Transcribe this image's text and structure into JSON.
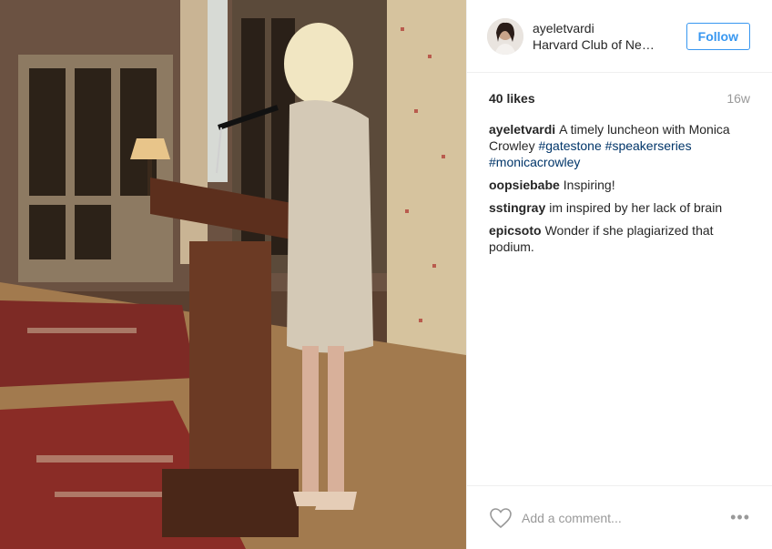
{
  "post": {
    "username": "ayeletvardi",
    "location": "Harvard Club of New York",
    "follow_label": "Follow",
    "likes": "40 likes",
    "age": "16w",
    "add_comment_placeholder": "Add a comment...",
    "more_icon": "more-dots-icon",
    "caption": {
      "user": "ayeletvardi",
      "text": "A timely luncheon with Monica Crowley",
      "tags": [
        "#gatestone",
        "#speakerseries",
        "#monicacrowley"
      ]
    },
    "comments": [
      {
        "user": "oopsiebabe",
        "text": "Inspiring!"
      },
      {
        "user": "sstingray",
        "text": "im inspired by her lack of brain"
      },
      {
        "user": "epicsoto",
        "text": "Wonder if she plagiarized that podium."
      }
    ]
  }
}
